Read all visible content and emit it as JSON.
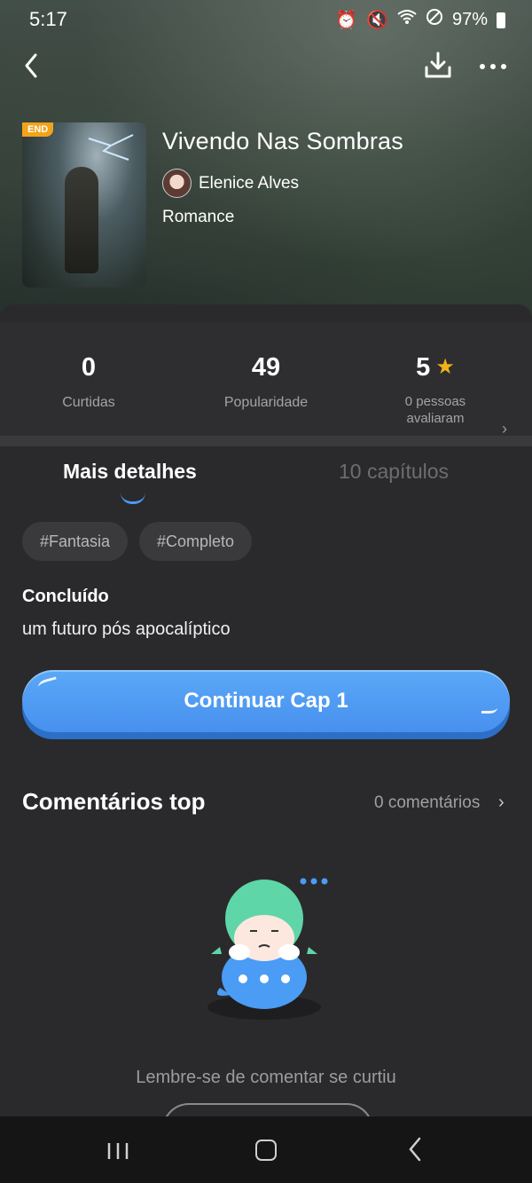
{
  "status_bar": {
    "time": "5:17",
    "battery": "97%",
    "icons": [
      "alarm-icon",
      "mute-icon",
      "wifi-icon",
      "do-not-disturb-icon",
      "battery-icon"
    ]
  },
  "header": {
    "back_icon": "chevron-left-icon",
    "download_icon": "download-icon",
    "more_icon": "more-horizontal-icon"
  },
  "book": {
    "badge": "END",
    "title": "Vivendo Nas Sombras",
    "author": "Elenice Alves",
    "genre": "Romance"
  },
  "stats": {
    "likes": {
      "value": "0",
      "label": "Curtidas"
    },
    "popularity": {
      "value": "49",
      "label": "Popularidade"
    },
    "rating": {
      "value": "5",
      "label_line1": "0 pessoas",
      "label_line2": "avaliaram"
    }
  },
  "tabs": {
    "details": "Mais detalhes",
    "chapters": "10 capítulos"
  },
  "tags": [
    "#Fantasia",
    "#Completo"
  ],
  "details": {
    "status": "Concluído",
    "synopsis": "um futuro pós apocalíptico"
  },
  "cta": {
    "label": "Continuar Cap 1"
  },
  "comments": {
    "title": "Comentários top",
    "count": "0 comentários",
    "empty_message": "Lembre-se de comentar se curtiu"
  },
  "colors": {
    "accent": "#4a9cf5",
    "star": "#f2b21a",
    "badge": "#f2a31a",
    "background": "#2a2a2c"
  }
}
